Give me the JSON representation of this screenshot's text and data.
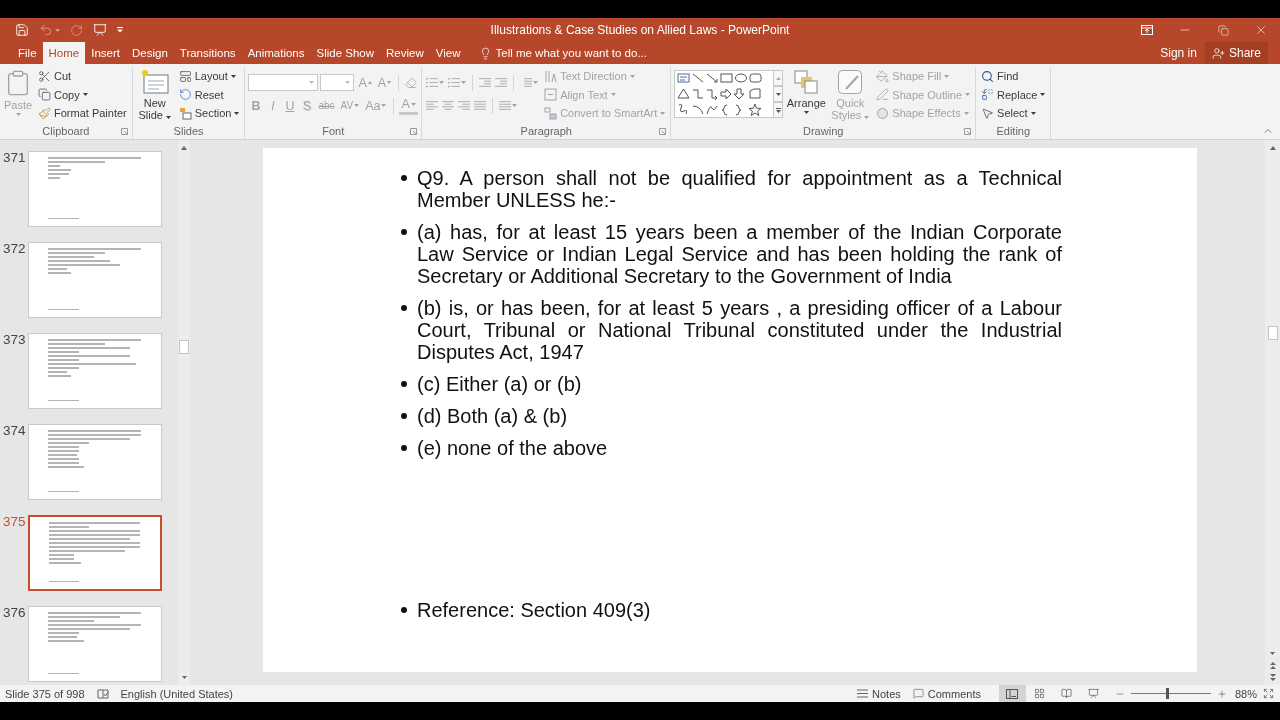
{
  "window": {
    "title": "Illustrations & Case Studies on Allied Laws - PowerPoint"
  },
  "quick_access": [
    {
      "kind": "save",
      "disabled": false
    },
    {
      "kind": "undo",
      "disabled": true
    },
    {
      "kind": "redo",
      "disabled": true
    },
    {
      "kind": "present",
      "disabled": false
    },
    {
      "kind": "customize",
      "disabled": false
    }
  ],
  "tabs": [
    {
      "label": "File",
      "selected": false
    },
    {
      "label": "Home",
      "selected": true
    },
    {
      "label": "Insert",
      "selected": false
    },
    {
      "label": "Design",
      "selected": false
    },
    {
      "label": "Transitions",
      "selected": false
    },
    {
      "label": "Animations",
      "selected": false
    },
    {
      "label": "Slide Show",
      "selected": false
    },
    {
      "label": "Review",
      "selected": false
    },
    {
      "label": "View",
      "selected": false
    }
  ],
  "tell_me": {
    "placeholder": "Tell me what you want to do..."
  },
  "account": {
    "sign_in": "Sign in",
    "share": "Share"
  },
  "ribbon": [
    {
      "kind": "clipboard",
      "label": "Clipboard",
      "items": [
        {
          "kind": "paste",
          "label": "Paste",
          "disabled": true
        },
        {
          "kind": "cut",
          "label": "Cut",
          "disabled": false
        },
        {
          "kind": "copy",
          "label": "Copy",
          "disabled": false
        },
        {
          "kind": "format_painter",
          "label": "Format Painter",
          "disabled": false
        }
      ]
    },
    {
      "kind": "slides",
      "label": "Slides",
      "items": [
        {
          "kind": "new_slide",
          "label": "New Slide",
          "disabled": false
        },
        {
          "kind": "layout",
          "label": "Layout",
          "disabled": false
        },
        {
          "kind": "reset",
          "label": "Reset",
          "disabled": false
        },
        {
          "kind": "section",
          "label": "Section",
          "disabled": false
        }
      ]
    },
    {
      "kind": "font",
      "label": "Font",
      "disabled": true,
      "items": [
        {
          "kind": "grow",
          "label": "A"
        },
        {
          "kind": "shrink",
          "label": "A"
        },
        {
          "kind": "bold",
          "label": "B"
        },
        {
          "kind": "italic",
          "label": "I"
        },
        {
          "kind": "underline",
          "label": "U"
        },
        {
          "kind": "shadow",
          "label": "S"
        },
        {
          "kind": "strikethrough",
          "label": "abc"
        },
        {
          "kind": "spacing",
          "label": "AV"
        },
        {
          "kind": "case",
          "label": "Aa"
        },
        {
          "kind": "color",
          "label": "A"
        }
      ]
    },
    {
      "kind": "paragraph",
      "label": "Paragraph",
      "disabled": true,
      "items": [
        {
          "kind": "text_direction",
          "label": "Text Direction"
        },
        {
          "kind": "align_text",
          "label": "Align Text"
        },
        {
          "kind": "smartart",
          "label": "Convert to SmartArt"
        }
      ]
    },
    {
      "kind": "drawing",
      "label": "Drawing",
      "items": [
        {
          "kind": "arrange",
          "label": "Arrange",
          "disabled": false
        },
        {
          "kind": "quick_styles",
          "label": "Quick Styles",
          "disabled": true
        },
        {
          "kind": "shape_fill",
          "label": "Shape Fill",
          "disabled": true
        },
        {
          "kind": "shape_outline",
          "label": "Shape Outline",
          "disabled": true
        },
        {
          "kind": "shape_effects",
          "label": "Shape Effects",
          "disabled": true
        }
      ]
    },
    {
      "kind": "editing",
      "label": "Editing",
      "items": [
        {
          "kind": "find",
          "label": "Find",
          "disabled": false
        },
        {
          "kind": "replace",
          "label": "Replace",
          "disabled": false
        },
        {
          "kind": "select",
          "label": "Select",
          "disabled": false
        }
      ]
    }
  ],
  "slides": [
    {
      "number": "371",
      "selected": false
    },
    {
      "number": "372",
      "selected": false
    },
    {
      "number": "373",
      "selected": false
    },
    {
      "number": "374",
      "selected": false
    },
    {
      "number": "375",
      "selected": true
    },
    {
      "number": "376",
      "selected": false
    }
  ],
  "slide": {
    "bullets": [
      "Q9. A person shall not be qualified for appointment as a Technical Member UNLESS he:-",
      "(a) has, for at least 15 years been a member of the Indian Corporate Law Service or Indian Legal Service and has been holding the rank of Secretary or Additional Secretary to the Government of India",
      "(b) is, or has been, for at least 5 years , a presiding officer of a Labour Court, Tribunal or National Tribunal constituted under the Industrial Disputes Act, 1947",
      "(c) Either (a) or (b)",
      "(d) Both (a) & (b)",
      "(e) none of the above"
    ],
    "reference": "Reference: Section 409(3)"
  },
  "status_bar": {
    "slide_info": "Slide 375 of 998",
    "language": "English (United States)",
    "notes": "Notes",
    "comments": "Comments",
    "views": [
      {
        "kind": "normal",
        "selected": true
      },
      {
        "kind": "sorter",
        "selected": false
      },
      {
        "kind": "reading",
        "selected": false
      },
      {
        "kind": "slideshow",
        "selected": false
      }
    ],
    "zoom": {
      "level": 0.45,
      "reading": "88%"
    }
  }
}
